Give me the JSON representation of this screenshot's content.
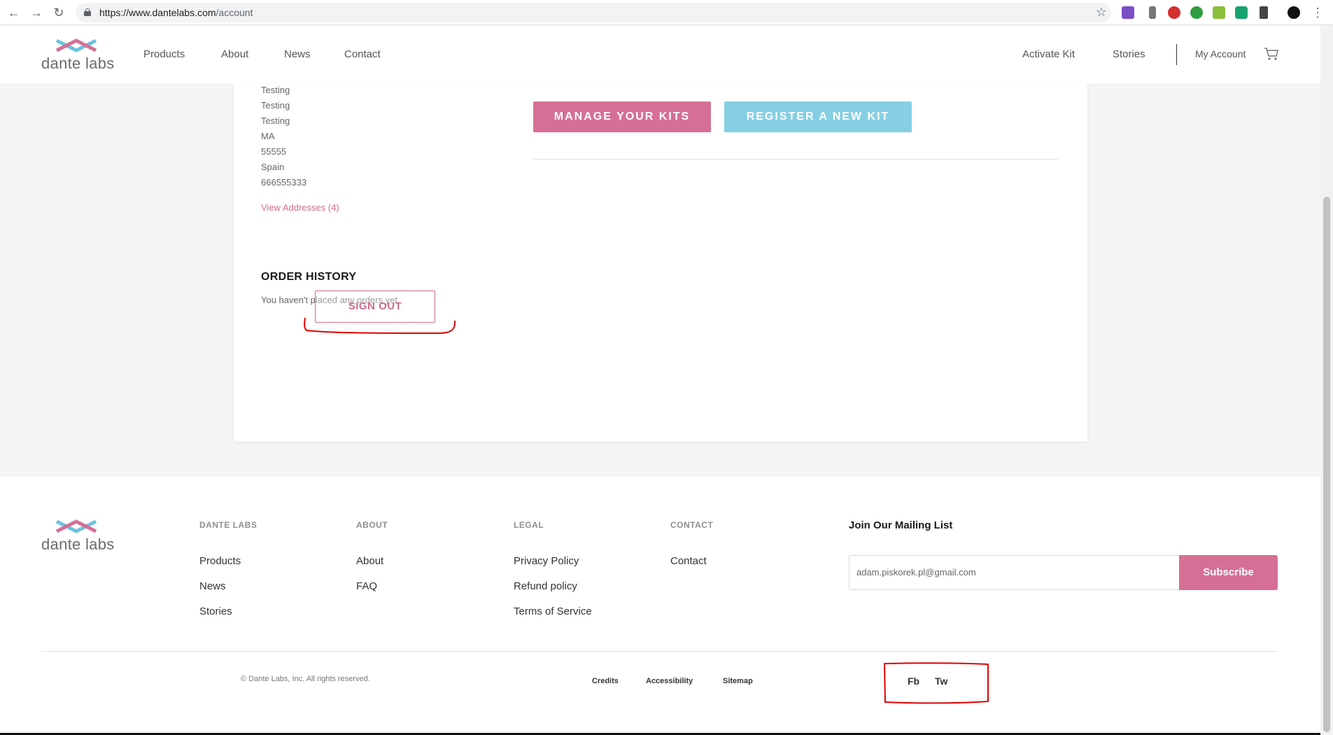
{
  "browser": {
    "url_host": "https://www.dantelabs.com",
    "url_path": "/account"
  },
  "header": {
    "logo_text": "dante labs",
    "nav": [
      "Products",
      "About",
      "News",
      "Contact"
    ],
    "right_nav": [
      "Activate Kit",
      "Stories"
    ],
    "account_label": "My Account"
  },
  "account": {
    "address_lines": [
      "Testing",
      "Testing",
      "Testing",
      "MA",
      "55555",
      "Spain",
      "666555333"
    ],
    "view_addresses": "View Addresses (4)",
    "manage_kits": "MANAGE YOUR KITS",
    "register_kit": "REGISTER A NEW KIT",
    "order_history_title": "ORDER HISTORY",
    "order_history_empty": "You haven't placed any orders yet.",
    "sign_out": "SIGN OUT"
  },
  "footer": {
    "logo_text": "dante labs",
    "columns": [
      {
        "heading": "DANTE LABS",
        "links": [
          "Products",
          "News",
          "Stories"
        ]
      },
      {
        "heading": "ABOUT",
        "links": [
          "About",
          "FAQ"
        ]
      },
      {
        "heading": "LEGAL",
        "links": [
          "Privacy Policy",
          "Refund policy",
          "Terms of Service"
        ]
      },
      {
        "heading": "CONTACT",
        "links": [
          "Contact"
        ]
      }
    ],
    "mailing_title": "Join Our Mailing List",
    "email_value": "adam.piskorek.pl@gmail.com",
    "subscribe": "Subscribe",
    "copyright": "© Dante Labs, Inc. All rights reserved.",
    "bottom_links": [
      "Credits",
      "Accessibility",
      "Sitemap"
    ],
    "social": [
      "Fb",
      "Tw"
    ]
  },
  "colors": {
    "pink": "#d56f96",
    "blue": "#86cfe3",
    "annotation_red": "#e00000"
  }
}
